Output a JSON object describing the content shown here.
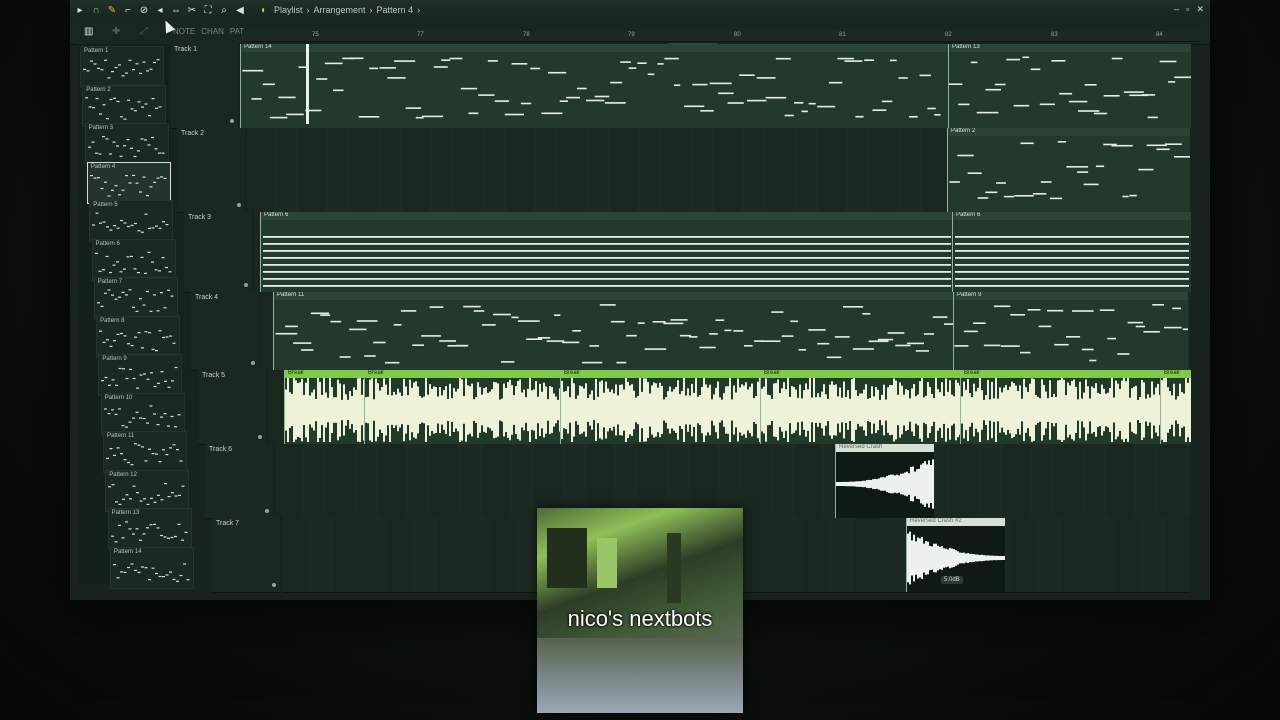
{
  "window": {
    "breadcrumb": [
      "Playlist",
      "Arrangement",
      "Pattern 4"
    ],
    "separator": "›"
  },
  "toolbar": {
    "snap_labels": [
      "NOTE",
      "CHAN",
      "PAT"
    ]
  },
  "ruler": {
    "bars": [
      "75",
      "77",
      "78",
      "79",
      "80",
      "81",
      "82",
      "83",
      "84"
    ]
  },
  "picker": {
    "patterns": [
      "Pattern 1",
      "Pattern 2",
      "Pattern 3",
      "Pattern 4",
      "Pattern 5",
      "Pattern 6",
      "Pattern 7",
      "Pattern 8",
      "Pattern 9",
      "Pattern 10",
      "Pattern 11",
      "Pattern 12",
      "Pattern 13",
      "Pattern 14"
    ],
    "selected": "Pattern 4"
  },
  "tracks": [
    {
      "name": "Track 1",
      "clips": [
        "Pattern 14",
        "Pattern 13"
      ]
    },
    {
      "name": "Track 2",
      "clips": [
        "Pattern 2"
      ]
    },
    {
      "name": "Track 3",
      "clips": [
        "Pattern 6",
        "Pattern 6"
      ]
    },
    {
      "name": "Track 4",
      "clips": [
        "Pattern 11",
        "Pattern 9"
      ]
    },
    {
      "name": "Track 5",
      "clips": [
        "Break",
        "Break",
        "Break",
        "Break",
        "Break",
        "Break"
      ]
    },
    {
      "name": "Track 6",
      "clips": [
        "Reversed Crash"
      ]
    },
    {
      "name": "Track 7",
      "clips": [
        "Reversed Crash #2"
      ],
      "gain": "5.0dB"
    }
  ],
  "overlay": {
    "caption": "nico's nextbots"
  }
}
